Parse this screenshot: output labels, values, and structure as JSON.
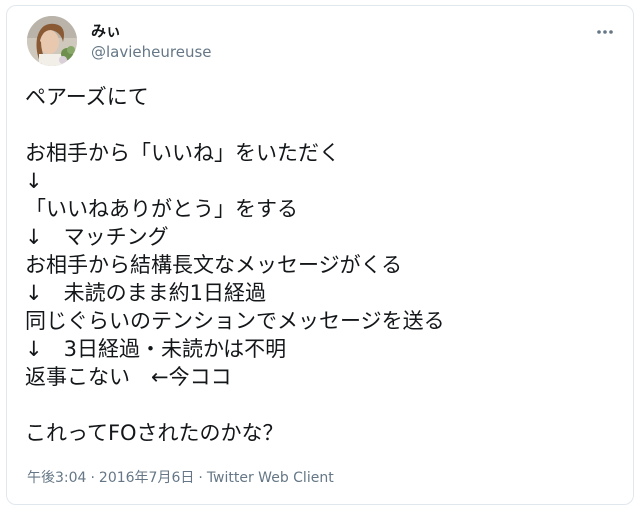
{
  "user": {
    "display_name": "みぃ",
    "handle": "@lavieheureuse"
  },
  "tweet": {
    "text": "ペアーズにて\n\nお相手から「いいね」をいただく\n↓\n「いいねありがとう」をする\n↓　マッチング\nお相手から結構長文なメッセージがくる\n↓　未読のまま約1日経過\n同じぐらいのテンションでメッセージを送る\n↓　3日経過・未読かは不明\n返事こない　←今ココ\n\nこれってFOされたのかな？"
  },
  "meta": {
    "time": "午後3:04",
    "date": "2016年7月6日",
    "client": "Twitter Web Client",
    "separator": "·"
  },
  "icons": {
    "more": "more-horizontal-icon",
    "avatar": "profile-photo"
  },
  "colors": {
    "text": "#14171a",
    "secondary": "#657786",
    "border": "#e1e8ed"
  }
}
